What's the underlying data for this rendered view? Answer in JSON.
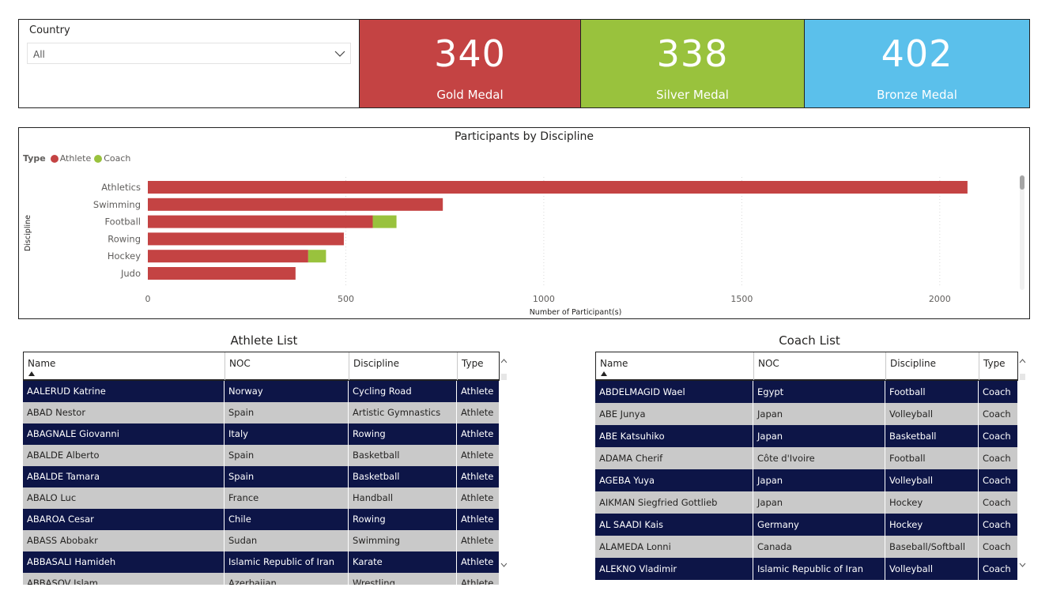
{
  "slicer": {
    "title": "Country",
    "value": "All"
  },
  "kpis": {
    "gold": {
      "value": "340",
      "label": "Gold Medal",
      "color": "#c44343"
    },
    "silver": {
      "value": "338",
      "label": "Silver Medal",
      "color": "#99c23d"
    },
    "bronze": {
      "value": "402",
      "label": "Bronze Medal",
      "color": "#5bc0eb"
    }
  },
  "chart_data": {
    "type": "bar",
    "orientation": "horizontal",
    "stacked": true,
    "title": "Participants by Discipline",
    "xlabel": "Number of Participant(s)",
    "ylabel": "Discipline",
    "legend_title": "Type",
    "legend_position": "top-left",
    "xlim": [
      0,
      2200
    ],
    "xticks": [
      0,
      500,
      1000,
      1500,
      2000
    ],
    "categories": [
      "Athletics",
      "Swimming",
      "Football",
      "Rowing",
      "Hockey",
      "Judo"
    ],
    "series": [
      {
        "name": "Athlete",
        "color": "#c44343",
        "values": [
          2070,
          745,
          568,
          495,
          405,
          373
        ]
      },
      {
        "name": "Coach",
        "color": "#99c23d",
        "values": [
          0,
          0,
          60,
          0,
          45,
          0
        ]
      }
    ],
    "grid": true
  },
  "athlete_list": {
    "title": "Athlete List",
    "columns": [
      "Name",
      "NOC",
      "Discipline",
      "Type"
    ],
    "rows": [
      [
        "AALERUD Katrine",
        "Norway",
        "Cycling Road",
        "Athlete"
      ],
      [
        "ABAD Nestor",
        "Spain",
        "Artistic Gymnastics",
        "Athlete"
      ],
      [
        "ABAGNALE Giovanni",
        "Italy",
        "Rowing",
        "Athlete"
      ],
      [
        "ABALDE Alberto",
        "Spain",
        "Basketball",
        "Athlete"
      ],
      [
        "ABALDE Tamara",
        "Spain",
        "Basketball",
        "Athlete"
      ],
      [
        "ABALO Luc",
        "France",
        "Handball",
        "Athlete"
      ],
      [
        "ABAROA Cesar",
        "Chile",
        "Rowing",
        "Athlete"
      ],
      [
        "ABASS Abobakr",
        "Sudan",
        "Swimming",
        "Athlete"
      ],
      [
        "ABBASALI Hamideh",
        "Islamic Republic of Iran",
        "Karate",
        "Athlete"
      ],
      [
        "ABBASOV Islam",
        "Azerbaijan",
        "Wrestling",
        "Athlete"
      ]
    ]
  },
  "coach_list": {
    "title": "Coach List",
    "columns": [
      "Name",
      "NOC",
      "Discipline",
      "Type"
    ],
    "rows": [
      [
        "ABDELMAGID Wael",
        "Egypt",
        "Football",
        "Coach"
      ],
      [
        "ABE Junya",
        "Japan",
        "Volleyball",
        "Coach"
      ],
      [
        "ABE Katsuhiko",
        "Japan",
        "Basketball",
        "Coach"
      ],
      [
        "ADAMA Cherif",
        "Côte d'Ivoire",
        "Football",
        "Coach"
      ],
      [
        "AGEBA Yuya",
        "Japan",
        "Volleyball",
        "Coach"
      ],
      [
        "AIKMAN Siegfried Gottlieb",
        "Japan",
        "Hockey",
        "Coach"
      ],
      [
        "AL SAADI Kais",
        "Germany",
        "Hockey",
        "Coach"
      ],
      [
        "ALAMEDA Lonni",
        "Canada",
        "Baseball/Softball",
        "Coach"
      ],
      [
        "ALEKNO Vladimir",
        "Islamic Republic of Iran",
        "Volleyball",
        "Coach"
      ]
    ]
  }
}
